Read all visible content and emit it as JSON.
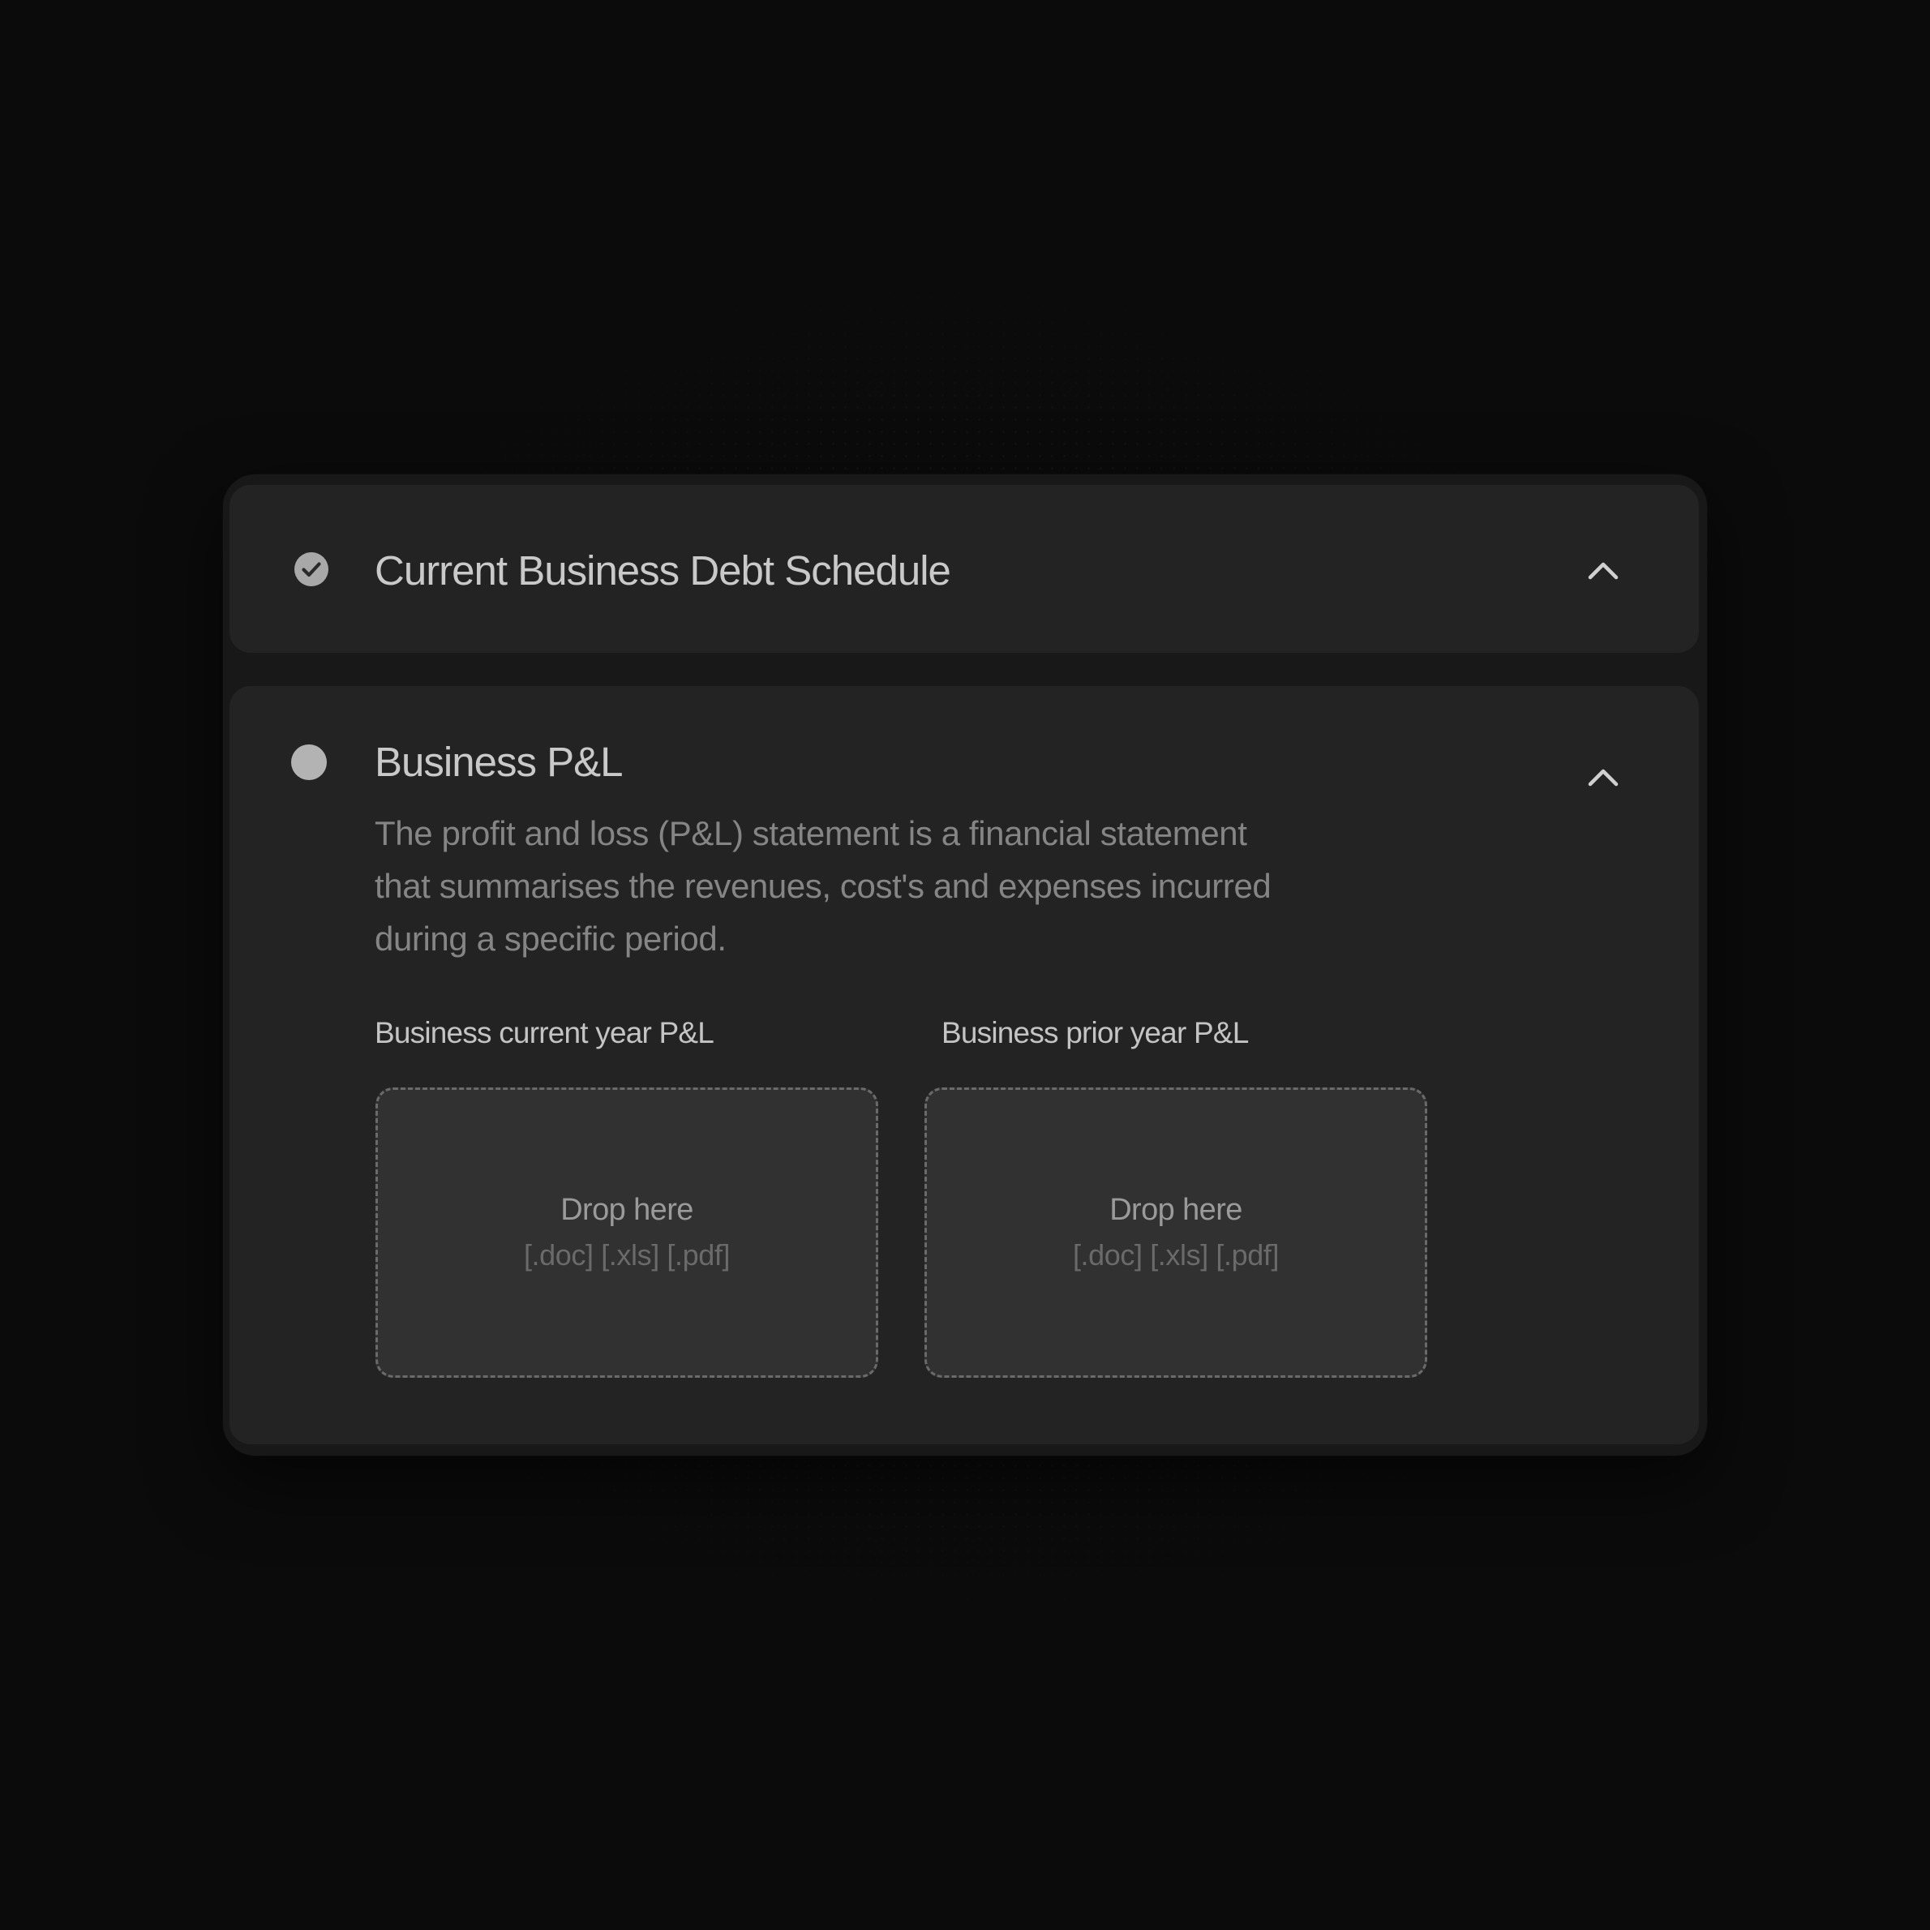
{
  "sections": [
    {
      "title": "Current Business Debt Schedule",
      "status": "complete",
      "status_icon": "check-circle-icon",
      "toggle_icon": "chevron-up-icon"
    },
    {
      "title": "Business P&L",
      "status": "pending",
      "status_icon": "circle-icon",
      "toggle_icon": "chevron-up-icon",
      "description_lines": [
        "The profit and loss (P&L)  statement is a financial statement",
        "that summarises the revenues, cost's and expenses incurred",
        "during a specific period."
      ],
      "uploads": [
        {
          "label": "Business current year P&L",
          "drop_text": "Drop here",
          "formats": "[.doc] [.xls] [.pdf]"
        },
        {
          "label": "Business prior year P&L",
          "drop_text": "Drop here",
          "formats": "[.doc] [.xls] [.pdf]"
        }
      ]
    }
  ],
  "colors": {
    "background": "#0b0b0b",
    "card": "#181818",
    "panel": "#232323",
    "dropzone": "#313131",
    "title_text": "#c9c9c9",
    "description_text": "#858585"
  }
}
